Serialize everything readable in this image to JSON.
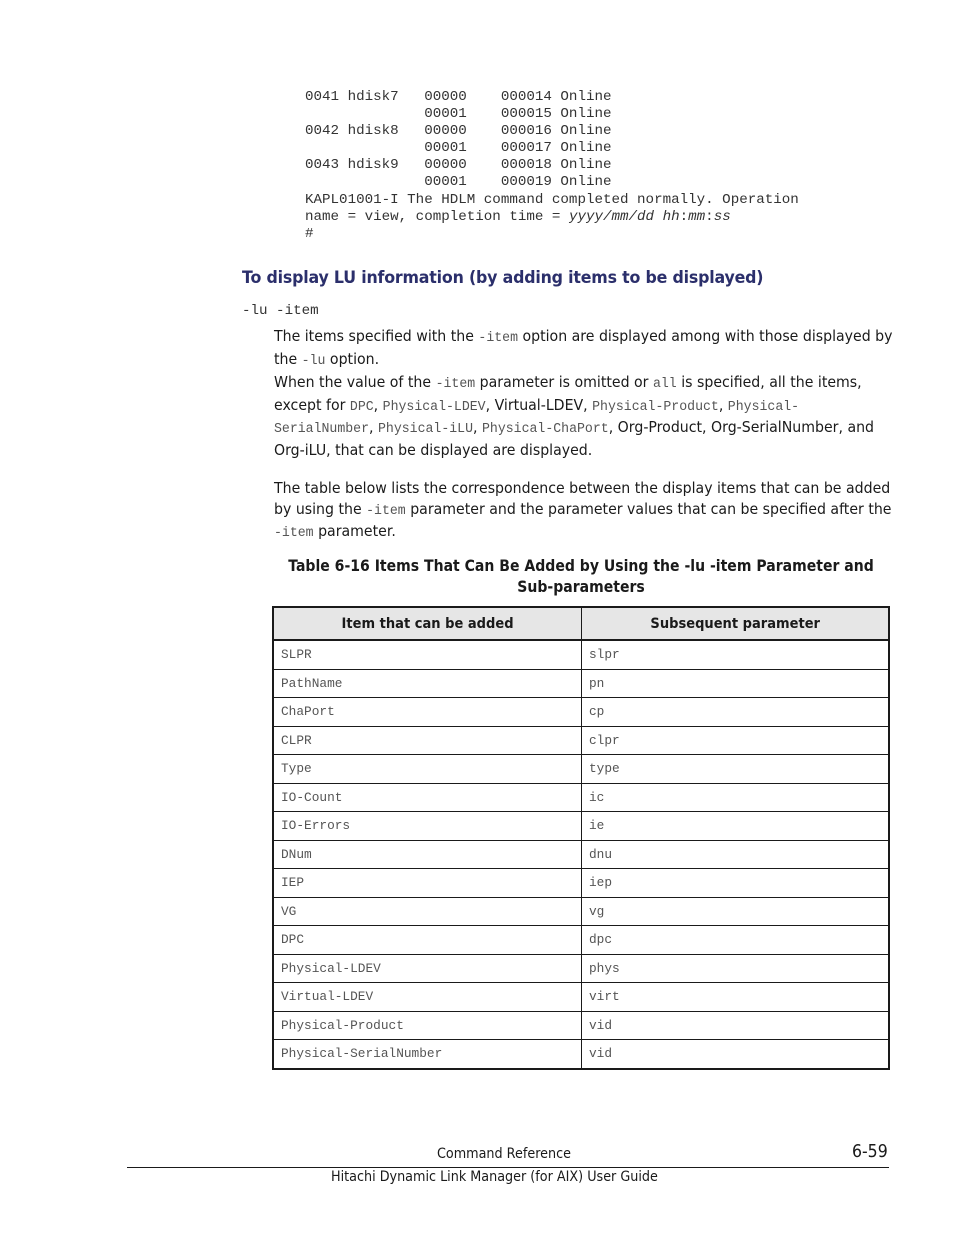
{
  "code_output": {
    "lines": [
      "0041 hdisk7   00000    000014 Online",
      "              00001    000015 Online",
      "0042 hdisk8   00000    000016 Online",
      "              00001    000017 Online",
      "0043 hdisk9   00000    000018 Online",
      "              00001    000019 Online",
      "KAPL01001-I The HDLM command completed normally. Operation"
    ],
    "completion_prefix": "name = view, completion time = ",
    "completion_date": "yyyy/mm/dd hh",
    "colon1": ":",
    "completion_min": "mm",
    "colon2": ":",
    "completion_sec": "ss",
    "prompt": "#"
  },
  "section": {
    "heading": "To display LU information (by adding items to be displayed)",
    "option": "-lu -item",
    "para1": {
      "t1": "The items specified with the ",
      "c1": "-item",
      "t2": " option are displayed among with those displayed by the ",
      "c2": "-lu",
      "t3": " option."
    },
    "para2": {
      "t1": "When the value of the ",
      "c1": "-item",
      "t2": " parameter is omitted or ",
      "c2": "all",
      "t3": " is specified, all the items, except for ",
      "c3": "DPC",
      "t4": ", ",
      "c4": "Physical-LDEV",
      "t5": ", Virtual-LDEV, ",
      "c5": "Physical-Product",
      "t6": ", ",
      "c6": "Physical-SerialNumber",
      "t7": ", ",
      "c7": "Physical-iLU",
      "t8": ", ",
      "c8": "Physical-ChaPort",
      "t9": ", Org-Product, Org-SerialNumber, and Org-iLU, that can be displayed are displayed."
    },
    "para3": {
      "t1": "The table below lists the correspondence between the display items that can be added by using the ",
      "c1": "-item",
      "t2": " parameter and the parameter values that can be specified after the ",
      "c2": "-item",
      "t3": " parameter."
    }
  },
  "table": {
    "caption": "Table 6-16 Items That Can Be Added by Using the -lu -item Parameter and Sub-parameters",
    "headers": [
      "Item that can be added",
      "Subsequent parameter"
    ],
    "rows": [
      [
        "SLPR",
        "slpr"
      ],
      [
        "PathName",
        "pn"
      ],
      [
        "ChaPort",
        "cp"
      ],
      [
        "CLPR",
        "clpr"
      ],
      [
        "Type",
        "type"
      ],
      [
        "IO-Count",
        "ic"
      ],
      [
        "IO-Errors",
        "ie"
      ],
      [
        "DNum",
        "dnu"
      ],
      [
        "IEP",
        "iep"
      ],
      [
        "VG",
        "vg"
      ],
      [
        "DPC",
        "dpc"
      ],
      [
        "Physical-LDEV",
        "phys"
      ],
      [
        "Virtual-LDEV",
        "virt"
      ],
      [
        "Physical-Product",
        "vid"
      ],
      [
        "Physical-SerialNumber",
        "vid"
      ]
    ]
  },
  "footer": {
    "section": "Command Reference",
    "page_number": "6-59",
    "guide_title": "Hitachi Dynamic Link Manager (for AIX) User Guide"
  },
  "colors": {
    "heading": "#2b2f6b",
    "table_header_bg": "#e6e6e6"
  }
}
